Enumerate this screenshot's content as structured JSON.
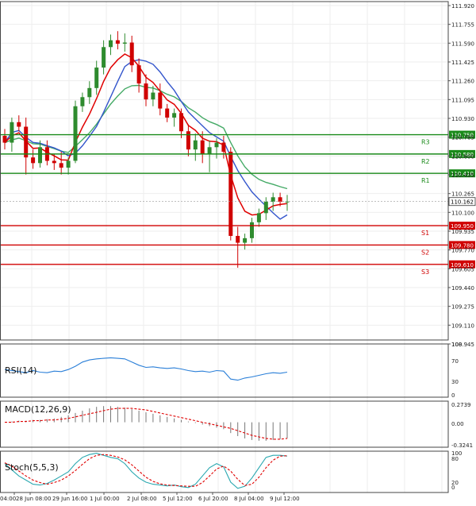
{
  "colors": {
    "bull": "#2e8b2e",
    "bear": "#d00000",
    "ma_fast": "#e00000",
    "ma_mid": "#3355cc",
    "ma_slow": "#44aa66",
    "resistance": "#1a8a1a",
    "support": "#d00000",
    "rsi": "#2a7fd8",
    "macd_signal": "#e00000",
    "stoch_k": "#2aa8b0",
    "stoch_d": "#e00000",
    "grid": "#eeeeee",
    "axis_text": "#222222"
  },
  "chart_data": [
    {
      "type": "candlestick",
      "ylim": [
        108.945,
        111.92
      ],
      "y_ticks": [
        "111.920",
        "111.755",
        "111.590",
        "111.425",
        "111.260",
        "111.095",
        "110.930",
        "110.765",
        "110.600",
        "110.435",
        "110.265",
        "110.100",
        "109.935",
        "109.770",
        "109.605",
        "109.440",
        "109.275",
        "109.110",
        "108.945"
      ],
      "current_price": "110.162",
      "x_labels": [
        "04:00",
        "28 Jun 08:00",
        "29 Jun 16:00",
        "1 Jul 00:00",
        "2 Jul 08:00",
        "5 Jul 12:00",
        "6 Jul 20:00",
        "8 Jul 04:00",
        "9 Jul 12:00"
      ],
      "levels": [
        {
          "name": "R3",
          "value": 110.75,
          "label": "110.750",
          "kind": "resistance"
        },
        {
          "name": "R2",
          "value": 110.58,
          "label": "110.580",
          "kind": "resistance"
        },
        {
          "name": "R1",
          "value": 110.41,
          "label": "110.410",
          "kind": "resistance"
        },
        {
          "name": "S1",
          "value": 109.95,
          "label": "109.950",
          "kind": "support"
        },
        {
          "name": "S2",
          "value": 109.78,
          "label": "109.780",
          "kind": "support"
        },
        {
          "name": "S3",
          "value": 109.61,
          "label": "109.610",
          "kind": "support"
        }
      ],
      "candles": [
        [
          110.74,
          110.8,
          110.62,
          110.68
        ],
        [
          110.68,
          110.9,
          110.6,
          110.86
        ],
        [
          110.86,
          110.92,
          110.78,
          110.82
        ],
        [
          110.82,
          110.9,
          110.4,
          110.55
        ],
        [
          110.55,
          110.62,
          110.45,
          110.5
        ],
        [
          110.5,
          110.7,
          110.46,
          110.64
        ],
        [
          110.64,
          110.7,
          110.48,
          110.52
        ],
        [
          110.52,
          110.58,
          110.44,
          110.5
        ],
        [
          110.5,
          110.6,
          110.4,
          110.46
        ],
        [
          110.46,
          110.55,
          110.4,
          110.52
        ],
        [
          110.52,
          111.05,
          110.5,
          111.0
        ],
        [
          111.0,
          111.12,
          110.95,
          111.08
        ],
        [
          111.08,
          111.22,
          111.02,
          111.16
        ],
        [
          111.16,
          111.4,
          111.1,
          111.34
        ],
        [
          111.34,
          111.58,
          111.28,
          111.52
        ],
        [
          111.52,
          111.63,
          111.45,
          111.58
        ],
        [
          111.58,
          111.66,
          111.5,
          111.55
        ],
        [
          111.55,
          111.64,
          111.48,
          111.56
        ],
        [
          111.56,
          111.62,
          111.3,
          111.36
        ],
        [
          111.36,
          111.42,
          111.12,
          111.2
        ],
        [
          111.2,
          111.28,
          111.0,
          111.06
        ],
        [
          111.06,
          111.18,
          111.0,
          111.12
        ],
        [
          111.12,
          111.2,
          110.92,
          110.98
        ],
        [
          110.98,
          111.02,
          110.86,
          110.9
        ],
        [
          110.9,
          110.98,
          110.82,
          110.94
        ],
        [
          110.94,
          110.98,
          110.72,
          110.78
        ],
        [
          110.78,
          110.84,
          110.56,
          110.62
        ],
        [
          110.62,
          110.76,
          110.52,
          110.7
        ],
        [
          110.7,
          110.78,
          110.5,
          110.58
        ],
        [
          110.58,
          110.7,
          110.42,
          110.64
        ],
        [
          110.64,
          110.72,
          110.54,
          110.68
        ],
        [
          110.68,
          110.74,
          110.54,
          110.6
        ],
        [
          110.6,
          110.64,
          109.82,
          109.86
        ],
        [
          109.86,
          109.94,
          109.58,
          109.8
        ],
        [
          109.8,
          109.88,
          109.74,
          109.84
        ],
        [
          109.84,
          110.02,
          109.8,
          109.98
        ],
        [
          109.98,
          110.1,
          109.94,
          110.06
        ],
        [
          110.06,
          110.2,
          110.0,
          110.16
        ],
        [
          110.16,
          110.24,
          110.08,
          110.2
        ],
        [
          110.2,
          110.24,
          110.12,
          110.16
        ],
        [
          110.16,
          110.22,
          110.08,
          110.162
        ]
      ]
    },
    {
      "type": "line",
      "title": "RSI(14)",
      "y_ticks": [
        "100",
        "70",
        "30",
        "0"
      ],
      "ylim": [
        0,
        100
      ],
      "values": [
        52,
        50,
        48,
        46,
        50,
        47,
        46,
        49,
        48,
        52,
        58,
        66,
        70,
        72,
        73,
        74,
        73,
        72,
        66,
        60,
        56,
        57,
        55,
        54,
        55,
        53,
        50,
        48,
        49,
        47,
        50,
        49,
        34,
        32,
        36,
        38,
        41,
        44,
        46,
        45,
        47
      ]
    },
    {
      "type": "histogram_line",
      "title": "MACD(12,26,9)",
      "y_ticks": [
        "0.2739",
        "0.00",
        "-0.3241"
      ],
      "ylim": [
        -0.3241,
        0.2739
      ],
      "histogram": [
        0.0,
        0.01,
        0.02,
        0.02,
        0.03,
        0.03,
        0.04,
        0.05,
        0.07,
        0.09,
        0.12,
        0.15,
        0.18,
        0.2,
        0.21,
        0.21,
        0.2,
        0.19,
        0.17,
        0.15,
        0.13,
        0.11,
        0.09,
        0.07,
        0.05,
        0.03,
        0.01,
        -0.01,
        -0.03,
        -0.05,
        -0.07,
        -0.09,
        -0.14,
        -0.18,
        -0.21,
        -0.23,
        -0.24,
        -0.24,
        -0.23,
        -0.22,
        -0.21
      ],
      "signal": [
        0.0,
        0.0,
        0.01,
        0.01,
        0.02,
        0.02,
        0.03,
        0.03,
        0.04,
        0.05,
        0.07,
        0.09,
        0.11,
        0.13,
        0.15,
        0.17,
        0.18,
        0.18,
        0.18,
        0.17,
        0.16,
        0.14,
        0.12,
        0.1,
        0.08,
        0.06,
        0.04,
        0.02,
        0.0,
        -0.02,
        -0.04,
        -0.06,
        -0.08,
        -0.11,
        -0.14,
        -0.17,
        -0.19,
        -0.21,
        -0.22,
        -0.22,
        -0.21
      ]
    },
    {
      "type": "line",
      "title": "Stoch(5,5,3)",
      "y_ticks": [
        "100",
        "80",
        "20",
        "0"
      ],
      "ylim": [
        0,
        100
      ],
      "k": [
        70,
        55,
        40,
        30,
        20,
        18,
        22,
        30,
        40,
        50,
        70,
        85,
        92,
        95,
        90,
        85,
        82,
        70,
        50,
        35,
        25,
        20,
        18,
        16,
        18,
        14,
        12,
        20,
        40,
        60,
        70,
        62,
        25,
        10,
        15,
        35,
        60,
        85,
        90,
        90,
        88
      ],
      "d": [
        72,
        64,
        52,
        40,
        30,
        24,
        20,
        24,
        30,
        40,
        53,
        68,
        82,
        90,
        92,
        90,
        86,
        79,
        67,
        52,
        37,
        27,
        21,
        18,
        17,
        16,
        15,
        15,
        24,
        40,
        57,
        64,
        52,
        32,
        17,
        20,
        37,
        60,
        78,
        88,
        89
      ]
    }
  ]
}
